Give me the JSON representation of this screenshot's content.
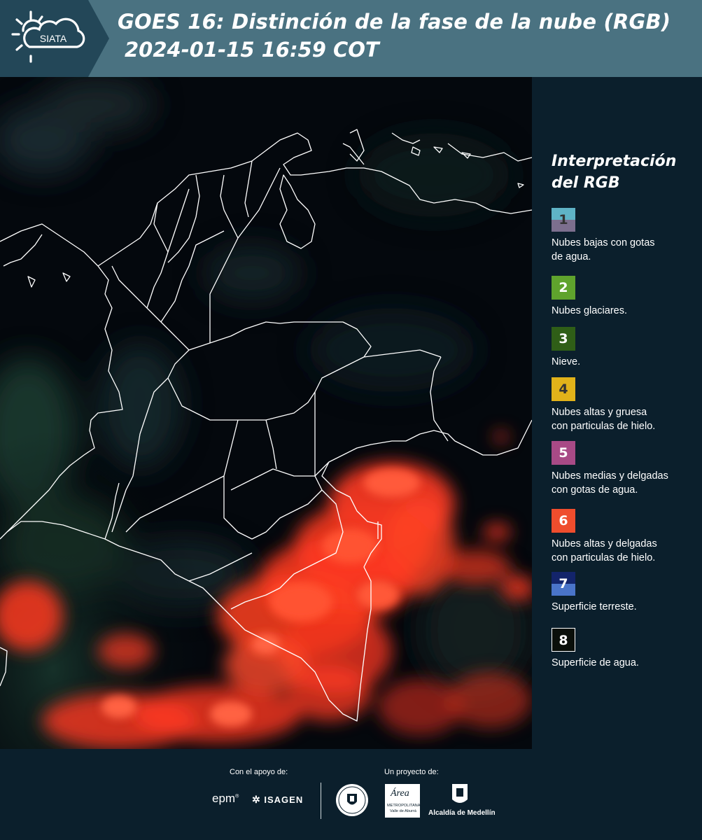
{
  "header": {
    "logo_text": "SIATA",
    "title": "GOES 16: Distinción de la fase de la nube (RGB)",
    "datetime": "2024-01-15 16:59 COT"
  },
  "legend": {
    "title_line1": "Interpretación",
    "title_line2": "del RGB",
    "items": [
      {
        "number": "1",
        "label_lines": [
          "Nubes bajas con gotas",
          "de agua."
        ],
        "color_top": "#5fb3c6",
        "color_bottom": "#7c6f8e",
        "text_color": "#333333"
      },
      {
        "number": "2",
        "label_lines": [
          "Nubes glaciares."
        ],
        "color_top": "#5fa32d",
        "color_bottom": "#5fa32d",
        "text_color": "#ffffff"
      },
      {
        "number": "3",
        "label_lines": [
          "Nieve."
        ],
        "color_top": "#2f5e17",
        "color_bottom": "#2f5e17",
        "text_color": "#ffffff"
      },
      {
        "number": "4",
        "label_lines": [
          "Nubes altas y gruesa",
          "con particulas de hielo."
        ],
        "color_top": "#e1b21a",
        "color_bottom": "#e1b21a",
        "text_color": "#333333"
      },
      {
        "number": "5",
        "label_lines": [
          "Nubes medias y delgadas",
          "con gotas de agua."
        ],
        "color_top": "#a84a86",
        "color_bottom": "#a84a86",
        "text_color": "#ffffff"
      },
      {
        "number": "6",
        "label_lines": [
          "Nubes altas y delgadas",
          "con particulas de hielo."
        ],
        "color_top": "#ef4d2d",
        "color_bottom": "#ef4d2d",
        "text_color": "#ffffff"
      },
      {
        "number": "7",
        "label_lines": [
          "Superficie terreste."
        ],
        "color_top": "#13246b",
        "color_bottom": "#4a74c9",
        "text_color": "#ffffff"
      },
      {
        "number": "8",
        "label_lines": [
          "Superficie de agua."
        ],
        "color_top": "#0a0f0a",
        "color_bottom": "#0a0f0a",
        "text_color": "#ffffff",
        "border": "#ffffff"
      }
    ]
  },
  "footer": {
    "support_label": "Con el apoyo de:",
    "project_label": "Un proyecto de:",
    "partner_epm": "epm",
    "partner_isagen": "ISAGEN",
    "partner_area_main": "Área",
    "partner_area_sub1": "METROPOLITANA",
    "partner_area_sub2": "Valle de Aburrá",
    "partner_alcaldia": "Alcaldía de Medellín"
  },
  "colors": {
    "header_bg": "#4a7281",
    "page_bg": "#0b1f2c",
    "map_bg": "#04080d",
    "cloud_red": "#ff3a22",
    "border_white": "#ffffff"
  }
}
